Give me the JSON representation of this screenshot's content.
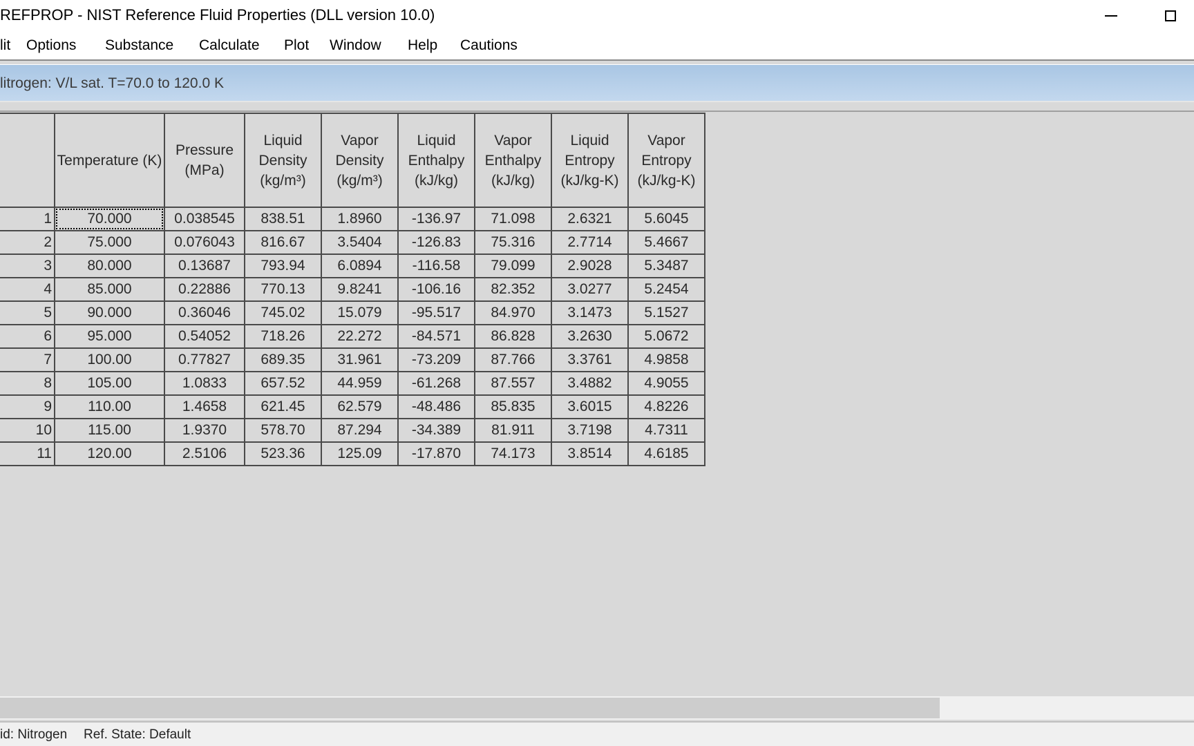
{
  "window": {
    "title": "REFPROP - NIST Reference Fluid Properties (DLL version 10.0)"
  },
  "menu": [
    {
      "label": "lit"
    },
    {
      "label": "Options"
    },
    {
      "label": "Substance"
    },
    {
      "label": "Calculate"
    },
    {
      "label": "Plot"
    },
    {
      "label": "Window"
    },
    {
      "label": "Help"
    },
    {
      "label": "Cautions"
    }
  ],
  "child_window": {
    "caption": "litrogen: V/L sat. T=70.0 to 120.0 K"
  },
  "table": {
    "columns": [
      "Temperature (K)",
      "Pressure (MPa)",
      "Liquid Density (kg/m³)",
      "Vapor Density (kg/m³)",
      "Liquid Enthalpy (kJ/kg)",
      "Vapor Enthalpy (kJ/kg)",
      "Liquid Entropy (kJ/kg-K)",
      "Vapor Entropy (kJ/kg-K)"
    ],
    "rows": [
      {
        "n": "1",
        "cells": [
          "70.000",
          "0.038545",
          "838.51",
          "1.8960",
          "-136.97",
          "71.098",
          "2.6321",
          "5.6045"
        ]
      },
      {
        "n": "2",
        "cells": [
          "75.000",
          "0.076043",
          "816.67",
          "3.5404",
          "-126.83",
          "75.316",
          "2.7714",
          "5.4667"
        ]
      },
      {
        "n": "3",
        "cells": [
          "80.000",
          "0.13687",
          "793.94",
          "6.0894",
          "-116.58",
          "79.099",
          "2.9028",
          "5.3487"
        ]
      },
      {
        "n": "4",
        "cells": [
          "85.000",
          "0.22886",
          "770.13",
          "9.8241",
          "-106.16",
          "82.352",
          "3.0277",
          "5.2454"
        ]
      },
      {
        "n": "5",
        "cells": [
          "90.000",
          "0.36046",
          "745.02",
          "15.079",
          "-95.517",
          "84.970",
          "3.1473",
          "5.1527"
        ]
      },
      {
        "n": "6",
        "cells": [
          "95.000",
          "0.54052",
          "718.26",
          "22.272",
          "-84.571",
          "86.828",
          "3.2630",
          "5.0672"
        ]
      },
      {
        "n": "7",
        "cells": [
          "100.00",
          "0.77827",
          "689.35",
          "31.961",
          "-73.209",
          "87.766",
          "3.3761",
          "4.9858"
        ]
      },
      {
        "n": "8",
        "cells": [
          "105.00",
          "1.0833",
          "657.52",
          "44.959",
          "-61.268",
          "87.557",
          "3.4882",
          "4.9055"
        ]
      },
      {
        "n": "9",
        "cells": [
          "110.00",
          "1.4658",
          "621.45",
          "62.579",
          "-48.486",
          "85.835",
          "3.6015",
          "4.8226"
        ]
      },
      {
        "n": "10",
        "cells": [
          "115.00",
          "1.9370",
          "578.70",
          "87.294",
          "-34.389",
          "81.911",
          "3.7198",
          "4.7311"
        ]
      },
      {
        "n": "11",
        "cells": [
          "120.00",
          "2.5106",
          "523.36",
          "125.09",
          "-17.870",
          "74.173",
          "3.8514",
          "4.6185"
        ]
      }
    ]
  },
  "status": {
    "fluid": "id: Nitrogen",
    "ref_state": "Ref. State: Default"
  },
  "colors": {
    "caption_gradient_top": "#a9c6e4",
    "client_background": "#d9d9d9"
  },
  "icons": [
    "minimize-icon",
    "maximize-icon"
  ]
}
